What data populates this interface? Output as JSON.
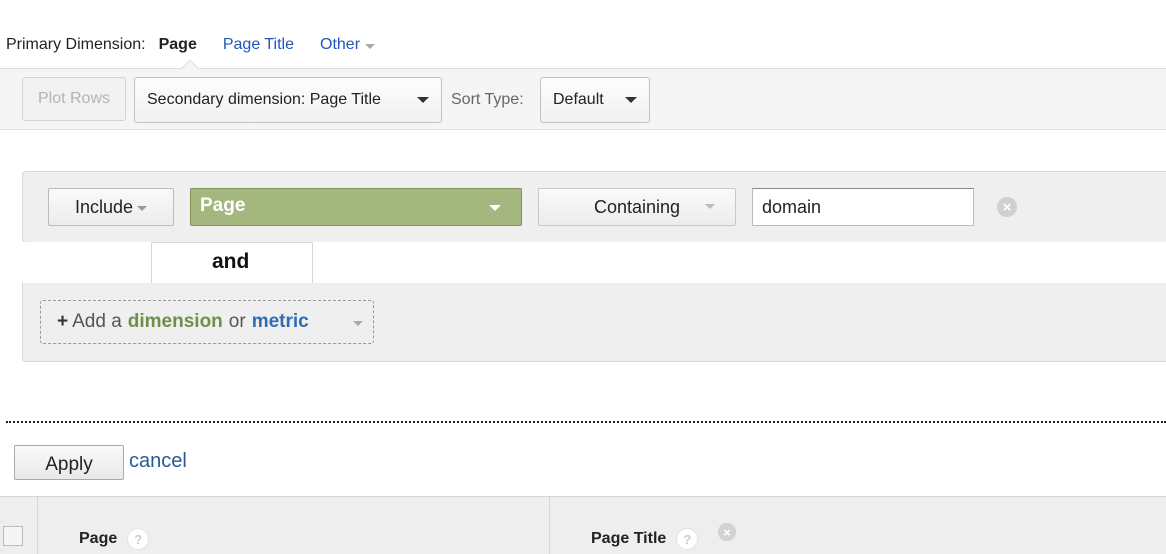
{
  "primary_dimension": {
    "label": "Primary Dimension:",
    "current": "Page",
    "links": [
      "Page Title"
    ],
    "other_label": "Other"
  },
  "toolbar": {
    "plot_rows": "Plot Rows",
    "secondary_dimension": "Secondary dimension: Page Title",
    "sort_type_label": "Sort Type:",
    "sort_type_value": "Default"
  },
  "filter": {
    "include_label": "Include",
    "dimension": "Page",
    "match_type": "Containing",
    "value": "domain",
    "and_label": "and",
    "add": {
      "plus": "+",
      "prefix": "Add a",
      "dimension": "dimension",
      "or": "or",
      "metric": "metric"
    }
  },
  "actions": {
    "apply": "Apply",
    "cancel": "cancel"
  },
  "table": {
    "columns": [
      {
        "label": "Page",
        "help": "?"
      },
      {
        "label": "Page Title",
        "help": "?"
      }
    ]
  },
  "icons": {
    "remove_condition": "remove-circle-icon",
    "remove_column": "remove-circle-icon",
    "help": "question-circle-icon"
  },
  "colors": {
    "link": "#2255bb",
    "dimension_green": "#a3b77e",
    "metric_blue": "#2f6db5"
  }
}
